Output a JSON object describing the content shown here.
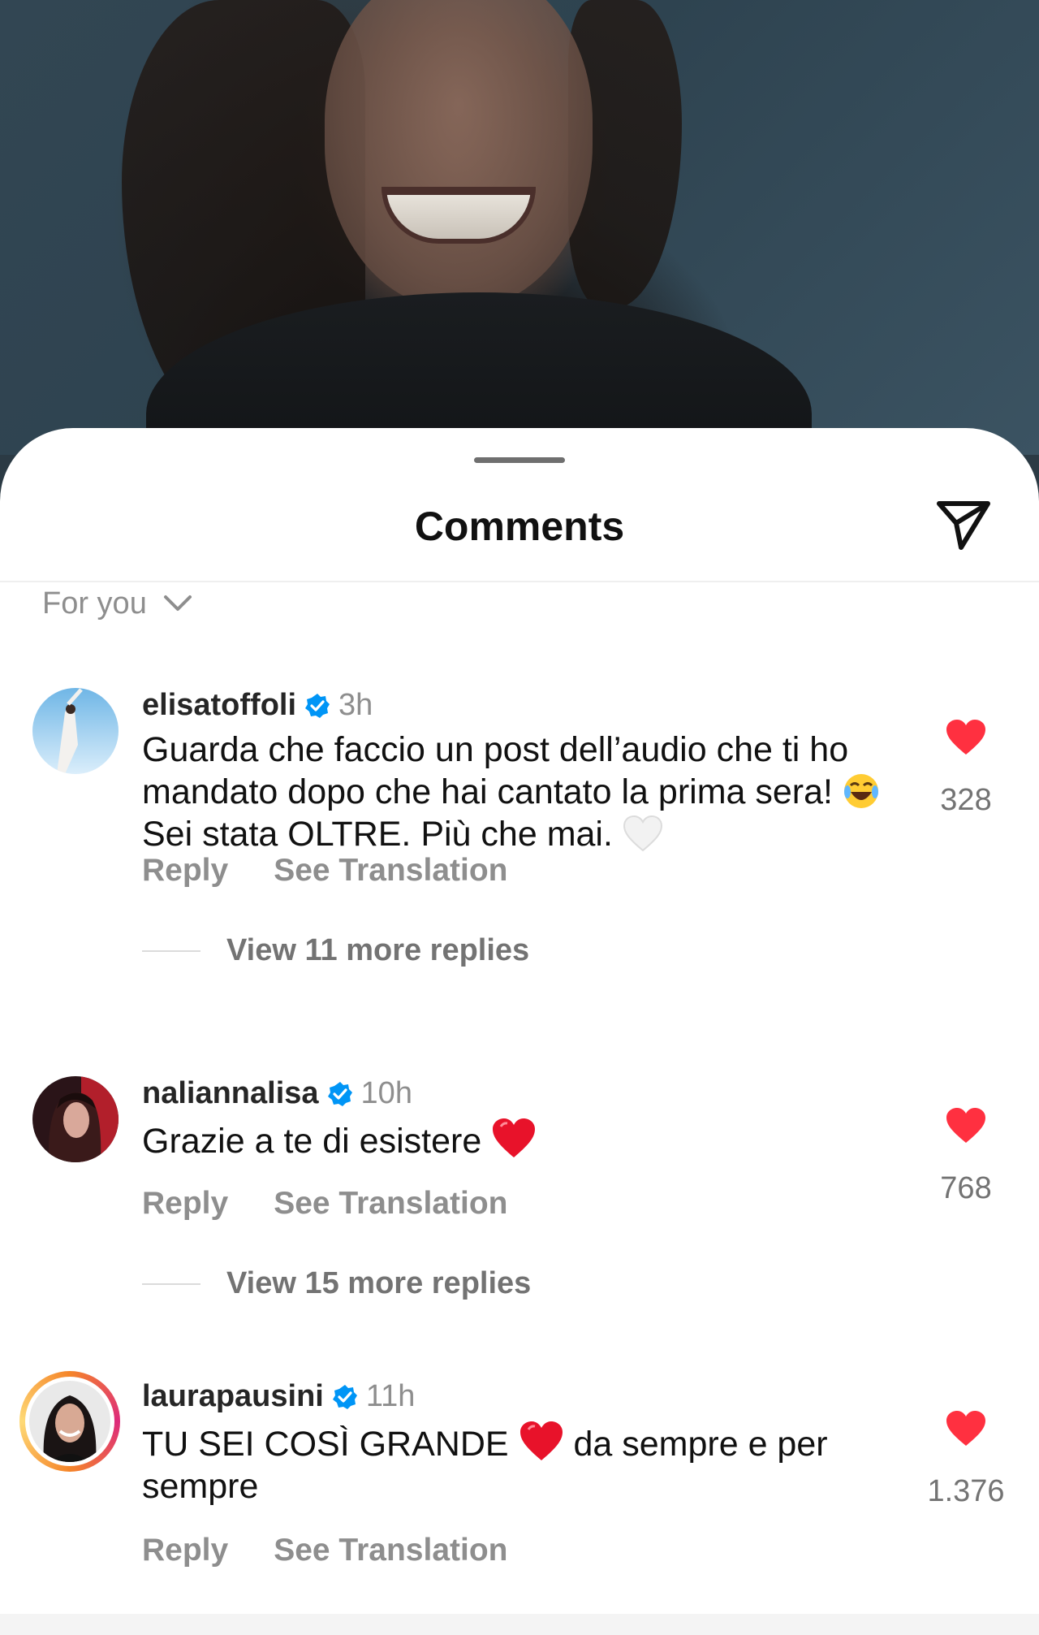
{
  "sheet": {
    "title": "Comments",
    "sort_label": "For you"
  },
  "comments": [
    {
      "username": "elisatoffoli",
      "time": "3h",
      "text_parts": [
        "Guarda che faccio un post dell’audio che ti ho mandato dopo che hai cantato la prima sera! ",
        " Sei stata OLTRE. Più che mai. "
      ],
      "likes": "328",
      "reply_label": "Reply",
      "translation_label": "See Translation",
      "view_replies": "View 11 more replies"
    },
    {
      "username": "naliannalisa",
      "time": "10h",
      "text_parts": [
        "Grazie a te di esistere "
      ],
      "likes": "768",
      "reply_label": "Reply",
      "translation_label": "See Translation",
      "view_replies": "View 15 more replies"
    },
    {
      "username": "laurapausini",
      "time": "11h",
      "text_parts": [
        "TU SEI COSÌ GRANDE ",
        " da sempre e per sempre"
      ],
      "likes": "1.376",
      "reply_label": "Reply",
      "translation_label": "See Translation"
    }
  ],
  "colors": {
    "heart": "#ff3040",
    "verified": "#0095f6",
    "muted": "#8e8e8e"
  },
  "icons": [
    "share-paper-plane-icon",
    "chevron-down-icon",
    "verified-badge-icon",
    "heart-filled-icon",
    "laughing-emoji-icon",
    "white-heart-emoji-icon",
    "red-heart-emoji-icon"
  ]
}
